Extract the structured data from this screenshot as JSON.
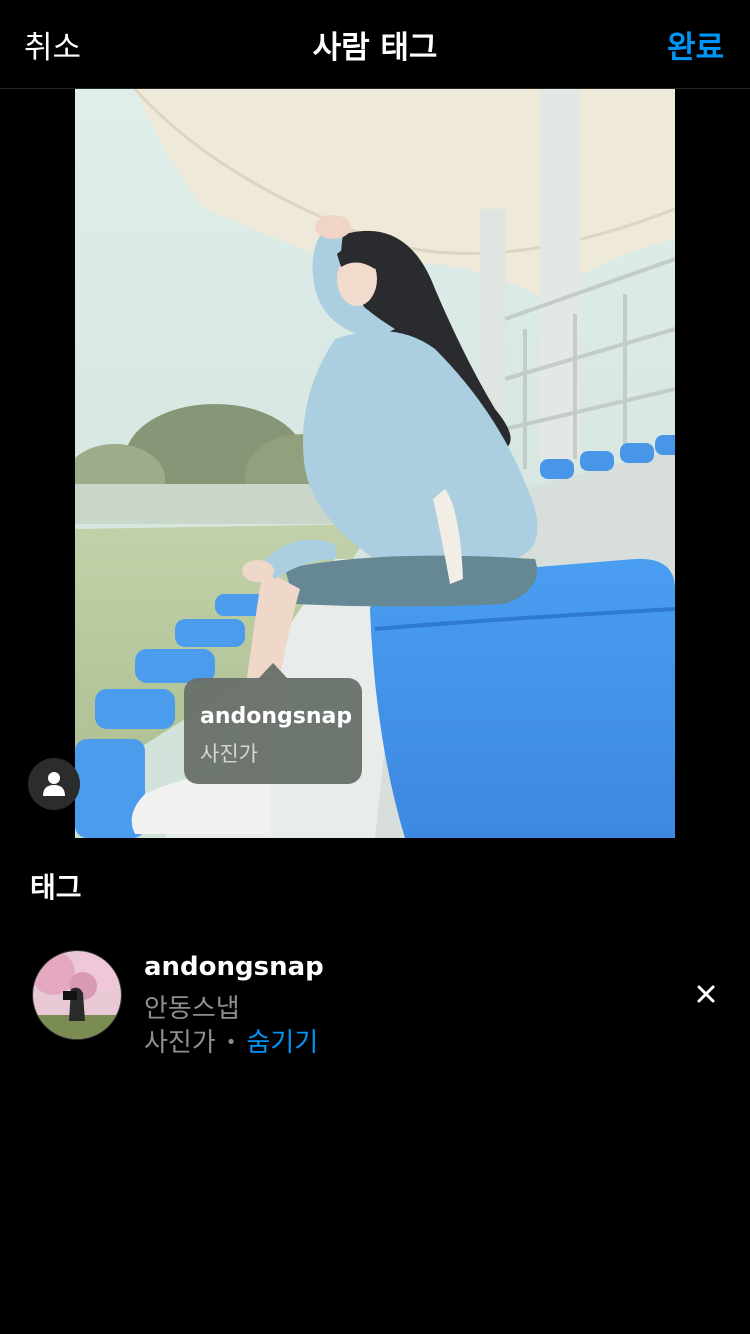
{
  "nav": {
    "cancel_label": "취소",
    "title": "사람 태그",
    "done_label": "완료",
    "done_color": "#0095f6"
  },
  "photo_tag": {
    "username": "andongsnap",
    "role": "사진가"
  },
  "tags_section": {
    "title": "태그",
    "items": [
      {
        "username": "andongsnap",
        "full_name": "안동스냅",
        "role": "사진가",
        "separator": "•",
        "hide_label": "숨기기"
      }
    ]
  },
  "icons": {
    "person_button": "person-icon",
    "remove": "close-icon"
  }
}
